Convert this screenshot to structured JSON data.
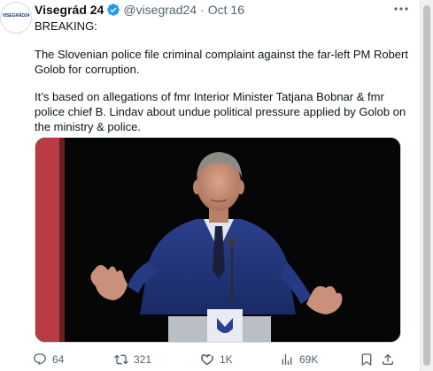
{
  "tweet": {
    "display_name": "Visegrád 24",
    "handle": "@visegrad24",
    "separator": "·",
    "time": "Oct 16",
    "avatar_text": "VISEGRÁD24",
    "paragraphs": [
      "BREAKING:",
      "The Slovenian police file criminal complaint against the far-left PM Robert Golob for corruption.",
      "It’s based on allegations of fmr Interior Minister Tatjana Bobnar & fmr police chief B. Lindav about undue political pressure applied by Golob on the ministry & police."
    ]
  },
  "actions": {
    "replies": "64",
    "reposts": "321",
    "likes": "1K",
    "views": "69K"
  },
  "colors": {
    "text": "#0f1419",
    "muted": "#536471",
    "verified": "#1d9bf0",
    "border": "#cfd9de"
  },
  "icons": [
    "verified-badge-icon",
    "more-icon",
    "reply-icon",
    "repost-icon",
    "like-icon",
    "views-icon",
    "bookmark-icon",
    "share-icon"
  ]
}
